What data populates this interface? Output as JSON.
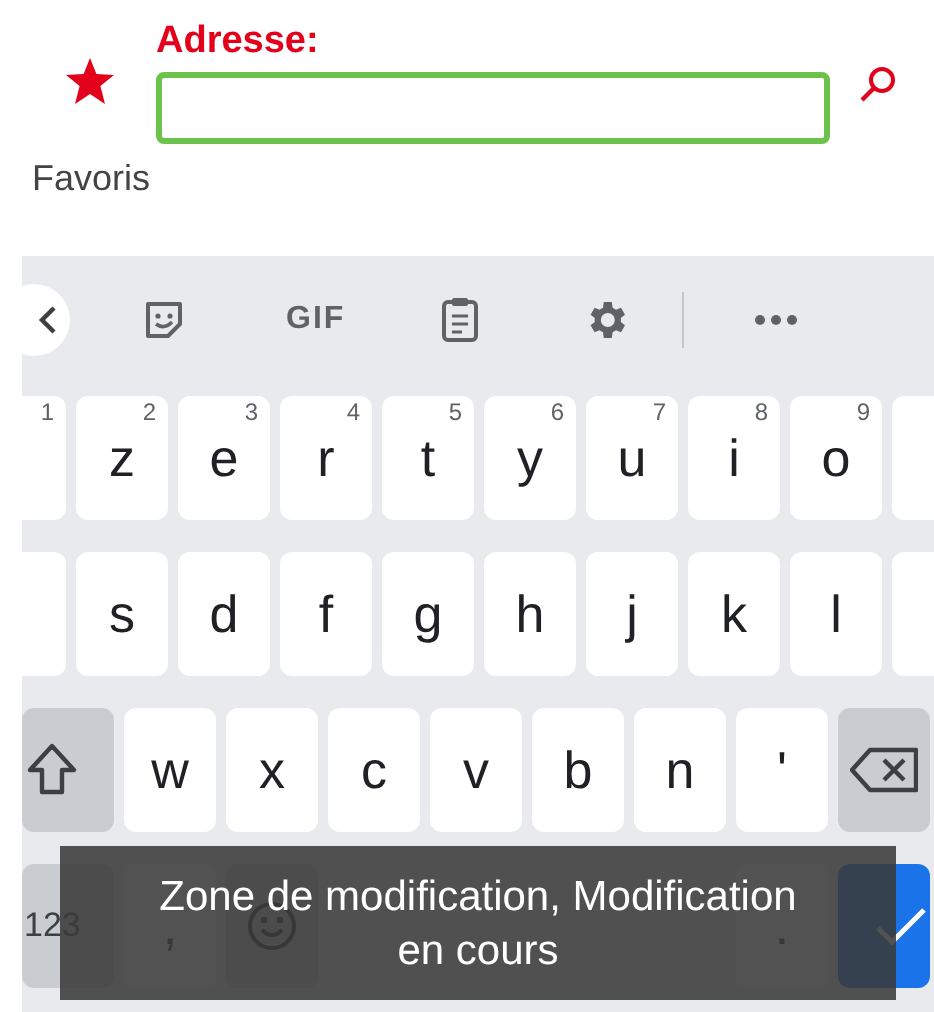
{
  "form": {
    "label": "Adresse:",
    "favorites": "Favoris"
  },
  "toolbar": {
    "gif": "GIF"
  },
  "rows": [
    [
      {
        "kind": "edge",
        "hint": "1"
      },
      {
        "kind": "letter",
        "label": "z",
        "hint": "2"
      },
      {
        "kind": "letter",
        "label": "e",
        "hint": "3"
      },
      {
        "kind": "letter",
        "label": "r",
        "hint": "4"
      },
      {
        "kind": "letter",
        "label": "t",
        "hint": "5"
      },
      {
        "kind": "letter",
        "label": "y",
        "hint": "6"
      },
      {
        "kind": "letter",
        "label": "u",
        "hint": "7"
      },
      {
        "kind": "letter",
        "label": "i",
        "hint": "8"
      },
      {
        "kind": "letter",
        "label": "o",
        "hint": "9"
      },
      {
        "kind": "edge"
      }
    ],
    [
      {
        "kind": "edge"
      },
      {
        "kind": "letter",
        "label": "s"
      },
      {
        "kind": "letter",
        "label": "d"
      },
      {
        "kind": "letter",
        "label": "f"
      },
      {
        "kind": "letter",
        "label": "g"
      },
      {
        "kind": "letter",
        "label": "h"
      },
      {
        "kind": "letter",
        "label": "j"
      },
      {
        "kind": "letter",
        "label": "k"
      },
      {
        "kind": "letter",
        "label": "l"
      },
      {
        "kind": "edge"
      }
    ],
    [
      {
        "kind": "shift"
      },
      {
        "kind": "letter",
        "label": "w"
      },
      {
        "kind": "letter",
        "label": "x"
      },
      {
        "kind": "letter",
        "label": "c"
      },
      {
        "kind": "letter",
        "label": "v"
      },
      {
        "kind": "letter",
        "label": "b"
      },
      {
        "kind": "letter",
        "label": "n"
      },
      {
        "kind": "letter",
        "label": "'"
      },
      {
        "kind": "backspace"
      }
    ],
    [
      {
        "kind": "mode",
        "label": "123"
      },
      {
        "kind": "letter",
        "label": ","
      },
      {
        "kind": "emoji"
      },
      {
        "kind": "letter",
        "label": "."
      },
      {
        "kind": "enter"
      }
    ]
  ],
  "toast": "Zone de modification, Modification en cours"
}
